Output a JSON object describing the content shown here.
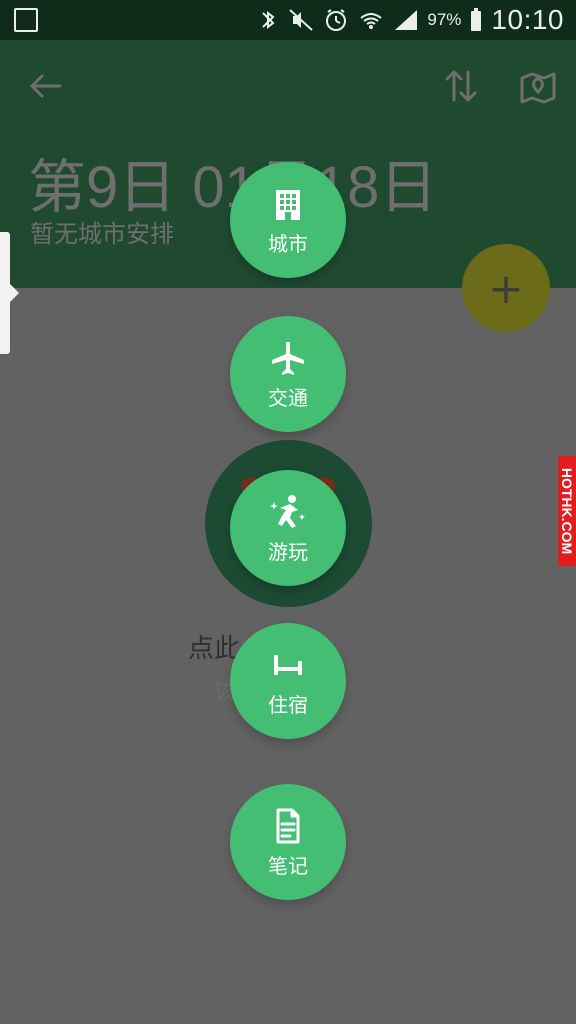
{
  "status_bar": {
    "battery": "97%",
    "time": "10:10",
    "icons": [
      "image-icon",
      "bluetooth-icon",
      "mute-icon",
      "alarm-icon",
      "wifi-icon",
      "signal-icon",
      "battery-icon"
    ]
  },
  "header": {
    "title": "第9日 01月18日",
    "subtitle": "暂无城市安排",
    "icons": [
      "back-arrow-icon",
      "sort-icon",
      "map-icon"
    ]
  },
  "fab": {
    "label": "+"
  },
  "empty_state": {
    "title": "点此      安排",
    "subtitle": "该     程"
  },
  "menu": [
    {
      "label": "城市",
      "icon": "building-icon"
    },
    {
      "label": "交通",
      "icon": "airplane-icon"
    },
    {
      "label": "游玩",
      "icon": "person-sparkles-icon"
    },
    {
      "label": "住宿",
      "icon": "bed-icon"
    },
    {
      "label": "笔记",
      "icon": "document-icon"
    }
  ],
  "watermark": "HOTHK.COM",
  "colors": {
    "dark_green": "#1f4a30",
    "menu_green": "#44be72",
    "overlay_gray": "#626262"
  }
}
